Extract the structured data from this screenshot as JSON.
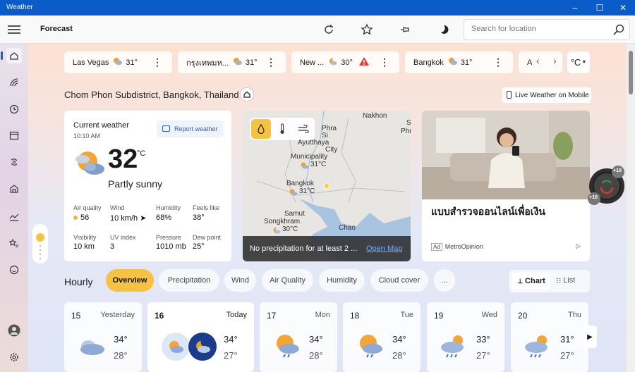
{
  "app": {
    "title": "Weather",
    "page_title": "Forecast"
  },
  "search": {
    "placeholder": "Search for location"
  },
  "locations": [
    {
      "name": "Las Vegas",
      "temp": "31°"
    },
    {
      "name": "กรุงเทพมห...",
      "temp": "31°"
    },
    {
      "name": "New ...",
      "temp": "30°"
    },
    {
      "name": "Bangkok",
      "temp": "31°"
    },
    {
      "name": "A",
      "temp": ""
    }
  ],
  "unit": "°C",
  "location_name": "Chom Phon Subdistrict, Bangkok, Thailand",
  "mobile_button": "Live Weather on Mobile",
  "current": {
    "heading": "Current weather",
    "time": "10:10 AM",
    "report": "Report weather",
    "temp": "32",
    "unit": "°C",
    "condition": "Partly sunny",
    "metrics": [
      {
        "label": "Air quality",
        "value": "56"
      },
      {
        "label": "Wind",
        "value": "10 km/h"
      },
      {
        "label": "Humidity",
        "value": "68%"
      },
      {
        "label": "Feels like",
        "value": "38°"
      },
      {
        "label": "Visibility",
        "value": "10 km"
      },
      {
        "label": "UV index",
        "value": "3"
      },
      {
        "label": "Pressure",
        "value": "1010 mb"
      },
      {
        "label": "Dew point",
        "value": "25°"
      }
    ]
  },
  "map": {
    "labels": [
      "Phra",
      "Si",
      "Ayutthaya",
      "City",
      "Municipality",
      "31°C",
      "Bangkok",
      "31°C",
      "Samut",
      "Songkhram",
      "30°C",
      "Chao",
      "Nakhon",
      "Si",
      "Phra"
    ],
    "footer": "No precipitation for at least 2 ...",
    "link": "Open Map"
  },
  "ad": {
    "title": "แบบสำรวจออนไลน์เพื่อเงิน",
    "badge": "Ad",
    "source": "MetroOpinion"
  },
  "gauge": {
    "top": "+10",
    "bottom": "+10"
  },
  "hourly": {
    "heading": "Hourly",
    "tabs": [
      "Overview",
      "Precipitation",
      "Wind",
      "Air Quality",
      "Humidity",
      "Cloud cover",
      "..."
    ],
    "chart": "Chart",
    "list": "List"
  },
  "days": [
    {
      "num": "15",
      "label": "Yesterday",
      "hi": "34°",
      "lo": "28°"
    },
    {
      "num": "16",
      "label": "Today",
      "hi": "34°",
      "lo": "27°"
    },
    {
      "num": "17",
      "label": "Mon",
      "hi": "34°",
      "lo": "28°"
    },
    {
      "num": "18",
      "label": "Tue",
      "hi": "34°",
      "lo": "28°"
    },
    {
      "num": "19",
      "label": "Wed",
      "hi": "33°",
      "lo": "27°"
    },
    {
      "num": "20",
      "label": "Thu",
      "hi": "31°",
      "lo": "27°"
    }
  ],
  "colors": {
    "accent": "#0b5cc8",
    "tab_active": "#f6c242",
    "alert": "#e53935"
  }
}
